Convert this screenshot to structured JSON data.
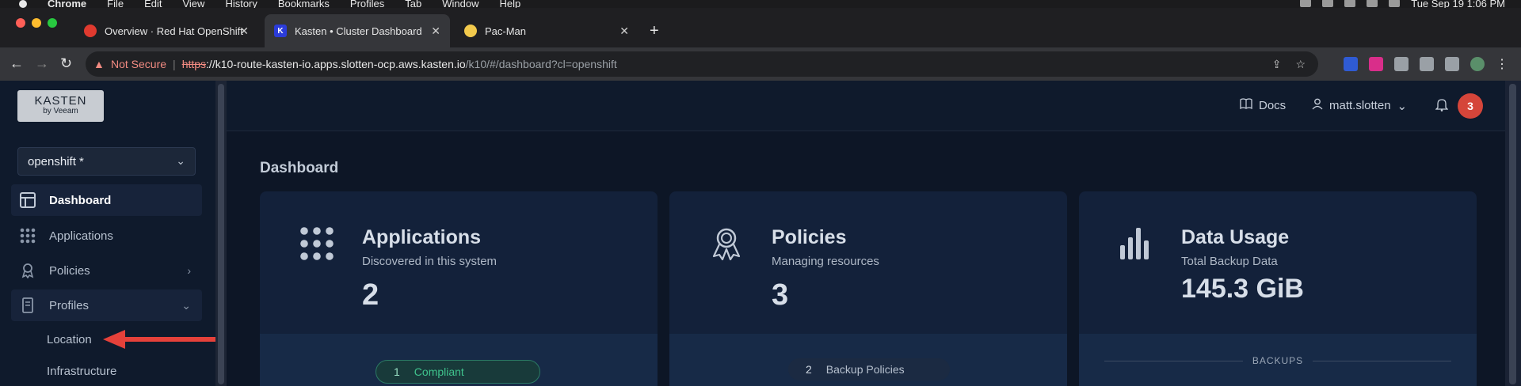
{
  "menubar": {
    "app": "Chrome",
    "items": [
      "File",
      "Edit",
      "View",
      "History",
      "Bookmarks",
      "Profiles",
      "Tab",
      "Window",
      "Help"
    ],
    "clock": "Tue Sep 19  1:06 PM"
  },
  "tabs": [
    {
      "title": "Overview · Red Hat OpenShift",
      "favicon_color": "#e03a2f"
    },
    {
      "title": "Kasten • Cluster Dashboard",
      "favicon_color": "#2b3cd9",
      "favicon_letter": "K"
    },
    {
      "title": "Pac-Man",
      "favicon_color": "#f2c94c"
    }
  ],
  "omnibox": {
    "security": "Not Secure",
    "scheme": "https",
    "host": "://k10-route-kasten-io.apps.slotten-ocp.aws.kasten.io",
    "path": "/k10/#/dashboard?cl=openshift"
  },
  "sidebar": {
    "logo_line1": "KASTEN",
    "logo_line2": "by Veeam",
    "cluster": "openshift *",
    "items": [
      {
        "label": "Dashboard",
        "icon": "dashboard-icon"
      },
      {
        "label": "Applications",
        "icon": "apps-grid-icon"
      },
      {
        "label": "Policies",
        "icon": "policy-icon"
      },
      {
        "label": "Profiles",
        "icon": "profile-icon"
      }
    ],
    "subitems": [
      "Location",
      "Infrastructure"
    ]
  },
  "header": {
    "docs": "Docs",
    "user": "matt.slotten",
    "notifications": "3"
  },
  "page_title": "Dashboard",
  "cards": [
    {
      "title": "Applications",
      "subtitle": "Discovered in this system",
      "value": "2",
      "pill_num": "1",
      "pill_label": "Compliant"
    },
    {
      "title": "Policies",
      "subtitle": "Managing resources",
      "value": "3",
      "pill_num": "2",
      "pill_label": "Backup Policies"
    },
    {
      "title": "Data Usage",
      "subtitle": "Total Backup Data",
      "value": "145.3 GiB",
      "section_label": "BACKUPS"
    }
  ],
  "colors": {
    "accent_green": "#3fc28c",
    "badge_red": "#d5453a",
    "arrow_red": "#e5413a"
  }
}
